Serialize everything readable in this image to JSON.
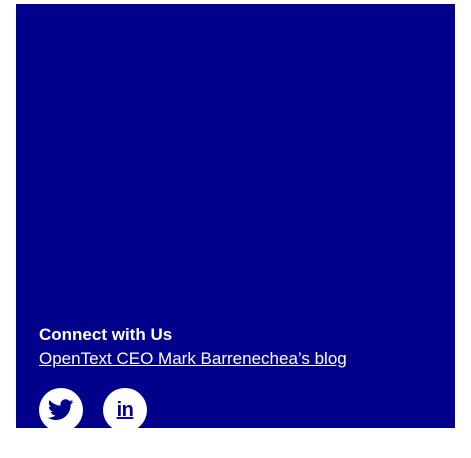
{
  "connect": {
    "heading": "Connect with Us",
    "blog_link": "OpenText CEO Mark Barrenechea’s blog"
  },
  "socials": [
    {
      "name": "twitter",
      "icon": "twitter-icon"
    },
    {
      "name": "linkedin",
      "icon": "linkedin-icon",
      "glyph": "in"
    }
  ],
  "colors": {
    "panel_bg": "#00008b",
    "text": "#ffffff"
  }
}
